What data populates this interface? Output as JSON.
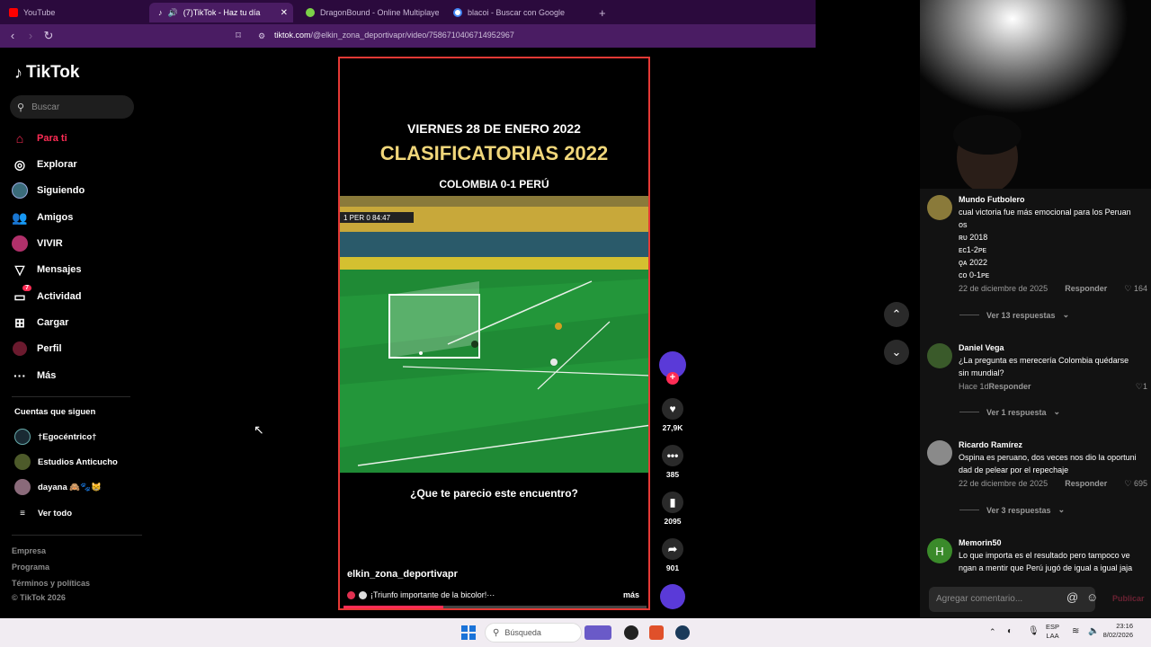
{
  "browser": {
    "tabs": [
      {
        "label": "YouTube",
        "color": "#ff0000"
      },
      {
        "label": "(7)TikTok - Haz tu día",
        "color": "#ffffff"
      },
      {
        "label": "DragonBound - Online Multiplayer F",
        "color": "#7bd148"
      },
      {
        "label": "blacoi - Buscar con Google",
        "color": "#4285f4"
      }
    ],
    "url_domain": "tiktok.com",
    "url_path": "/@elkin_zona_deportivapr/video/7586710406714952967"
  },
  "sidebar": {
    "logo": "TikTok",
    "search_placeholder": "Buscar",
    "nav": [
      {
        "label": "Para ti",
        "icon": "home-icon"
      },
      {
        "label": "Explorar",
        "icon": "compass-icon"
      },
      {
        "label": "Siguiendo",
        "icon": "following-icon"
      },
      {
        "label": "Amigos",
        "icon": "friends-icon"
      },
      {
        "label": "VIVIR",
        "icon": "live-icon"
      },
      {
        "label": "Mensajes",
        "icon": "messages-icon"
      },
      {
        "label": "Actividad",
        "icon": "activity-icon"
      },
      {
        "label": "Cargar",
        "icon": "upload-icon"
      },
      {
        "label": "Perfil",
        "icon": "profile-icon"
      },
      {
        "label": "Más",
        "icon": "more-icon"
      }
    ],
    "activity_badge": "7",
    "following_title": "Cuentas que siguen",
    "following": [
      {
        "name": "†Egocéntrico†"
      },
      {
        "name": "Estudios Anticucho"
      },
      {
        "name": "dayana 🙈🐾😸"
      }
    ],
    "see_all": "Ver todo",
    "footer": [
      "Empresa",
      "Programa",
      "Términos y políticas",
      "© TikTok 2026"
    ]
  },
  "video": {
    "title_line1": "VIERNES 28 DE ENERO 2022",
    "title_line2": "CLASIFICATORIAS 2022",
    "title_line3": "COLOMBIA 0-1 PERÚ",
    "scoreboard": "1 PER 0 84:47",
    "caption": "¿Que te parecio este encuentro?",
    "author": "elkin_zona_deportivapr",
    "description": "¡Triunfo importante de la bicolor!···",
    "more": "más",
    "progress": 0.33
  },
  "actions": {
    "likes": "27,9K",
    "comments": "385",
    "saves": "2095",
    "shares": "901"
  },
  "comments": [
    {
      "name": "Mundo Futbolero",
      "text": [
        "cual victoria fue más emocional para los Peruan",
        "os",
        "ʀᴜ 2018",
        "ᴇᴄ1-2ᴘᴇ",
        "ǫᴀ 2022",
        "ᴄᴏ 0-1ᴘᴇ"
      ],
      "date": "22 de diciembre de 2025",
      "reply": "Responder",
      "likes": "164",
      "replies": "Ver 13 respuestas"
    },
    {
      "name": "Daniel Vega",
      "text": [
        "¿La pregunta es merecería Colombia quédarse",
        "sin mundial?"
      ],
      "date": "Hace 1d",
      "reply": "Responder",
      "likes": "1",
      "replies": "Ver 1 respuesta"
    },
    {
      "name": "Ricardo Ramírez",
      "text": [
        "Ospina es peruano, dos veces nos dio la oportuni",
        "dad de pelear por el repechaje"
      ],
      "date": "22 de diciembre de 2025",
      "reply": "Responder",
      "likes": "695",
      "replies": "Ver 3 respuestas"
    },
    {
      "name": "Memorin50",
      "avatar_letter": "H",
      "text": [
        "Lo que importa es el resultado pero tampoco ve",
        "ngan a mentir que Perú jugó de igual a igual jaja"
      ]
    }
  ],
  "comment_input_placeholder": "Agregar comentario...",
  "post_label": "Publicar",
  "taskbar": {
    "search": "Búsqueda",
    "lang": "ESP",
    "lang2": "LAA",
    "time": "23:16",
    "date": "8/02/2026"
  }
}
